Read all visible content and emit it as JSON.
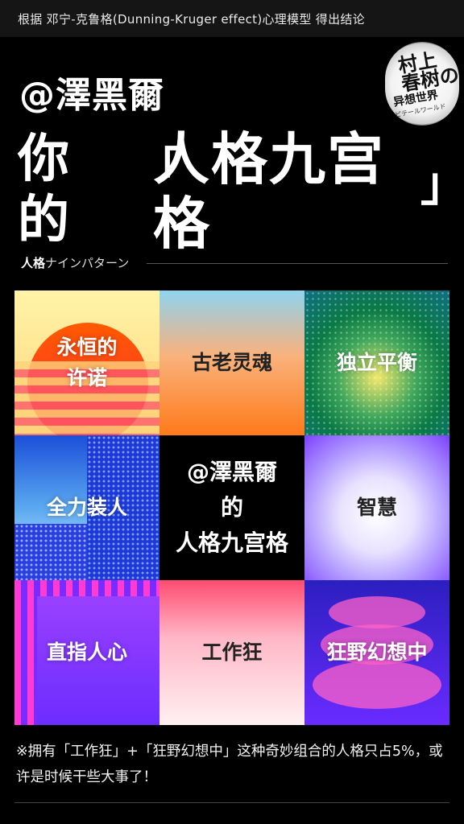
{
  "header": {
    "caption": "根据 邓宁-克鲁格(Dunning-Kruger effect)心理模型 得出结论"
  },
  "title": {
    "handle": "@澤黑爾",
    "prefix_line1": "你",
    "prefix_line2": "的",
    "open_bracket": "「",
    "close_bracket": "」",
    "main_line1": "人格九宫",
    "main_line2": "格"
  },
  "logo": {
    "line1": "村上",
    "line2": "春树の",
    "line3": "异想世界",
    "line4": "ピテールワールド"
  },
  "subtitle": {
    "bold": "人格",
    "rest": "ナインパターン"
  },
  "grid": [
    {
      "label": "永恒的\n许诺"
    },
    {
      "label": "古老灵魂"
    },
    {
      "label": "独立平衡"
    },
    {
      "label": "全力装人"
    },
    {
      "label": "@澤黑爾\n的\n人格九宫格"
    },
    {
      "label": "智慧"
    },
    {
      "label": "直指人心"
    },
    {
      "label": "工作狂"
    },
    {
      "label": "狂野幻想中"
    }
  ],
  "note": "※拥有「工作狂」+「狂野幻想中」这种奇妙组合的人格只占5%，或许是时候干些大事了！"
}
